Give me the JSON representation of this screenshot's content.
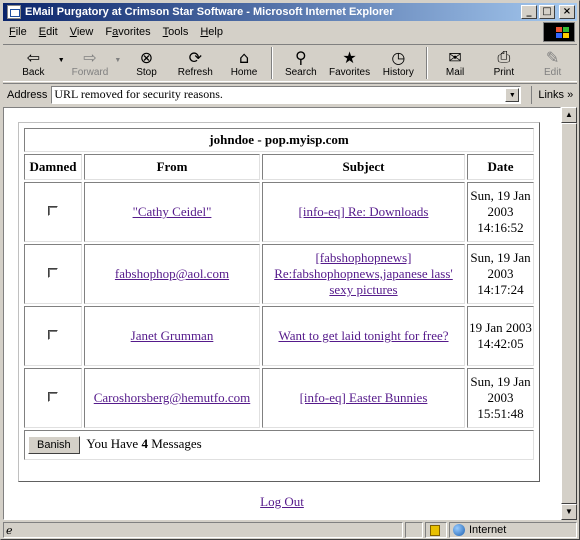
{
  "window": {
    "title": "EMail Purgatory at Crimson Star Software - Microsoft Internet Explorer",
    "min_glyph": "_",
    "max_glyph": "□",
    "close_glyph": "×"
  },
  "menu": {
    "items": [
      {
        "ul": "F",
        "rest": "ile"
      },
      {
        "ul": "E",
        "rest": "dit"
      },
      {
        "ul": "V",
        "rest": "iew"
      },
      {
        "pre": "F",
        "ul": "a",
        "rest": "vorites"
      },
      {
        "ul": "T",
        "rest": "ools"
      },
      {
        "ul": "H",
        "rest": "elp"
      }
    ]
  },
  "toolbar": {
    "back": "Back",
    "forward": "Forward",
    "stop": "Stop",
    "refresh": "Refresh",
    "home": "Home",
    "search": "Search",
    "favorites": "Favorites",
    "history": "History",
    "mail": "Mail",
    "print": "Print",
    "edit": "Edit"
  },
  "address": {
    "label": "Address",
    "value": "URL removed for security reasons.",
    "links": "Links"
  },
  "mailbox": {
    "account": "johndoe - pop.myisp.com",
    "columns": {
      "damned": "Damned",
      "from": "From",
      "subject": "Subject",
      "date": "Date"
    },
    "messages": [
      {
        "from": "\"Cathy Ceidel\"",
        "subject": "[info-eq] Re: Downloads",
        "date": "Sun, 19 Jan 2003 14:16:52",
        "damned": false
      },
      {
        "from": "fabshophop@aol.com",
        "subject": "[fabshophopnews] Re:fabshophopnews,japanese lass' sexy pictures",
        "date": "Sun, 19 Jan 2003 14:17:24",
        "damned": false
      },
      {
        "from": "Janet Grumman",
        "subject": "Want to get laid tonight for free?",
        "date": "19 Jan 2003 14:42:05",
        "damned": false
      },
      {
        "from": "Caroshorsberg@hemutfo.com",
        "subject": "[info-eq] Easter Bunnies",
        "date": "Sun, 19 Jan 2003 15:51:48",
        "damned": false
      }
    ],
    "banish_label": "Banish",
    "count_prefix": "You Have ",
    "count": "4",
    "count_suffix": " Messages"
  },
  "logout": "Log Out",
  "status": {
    "zone": "Internet"
  },
  "colors": {
    "title_start": "#0a246a",
    "title_end": "#a6caf0",
    "link": "#551a8b",
    "chrome": "#d4d0c8"
  }
}
